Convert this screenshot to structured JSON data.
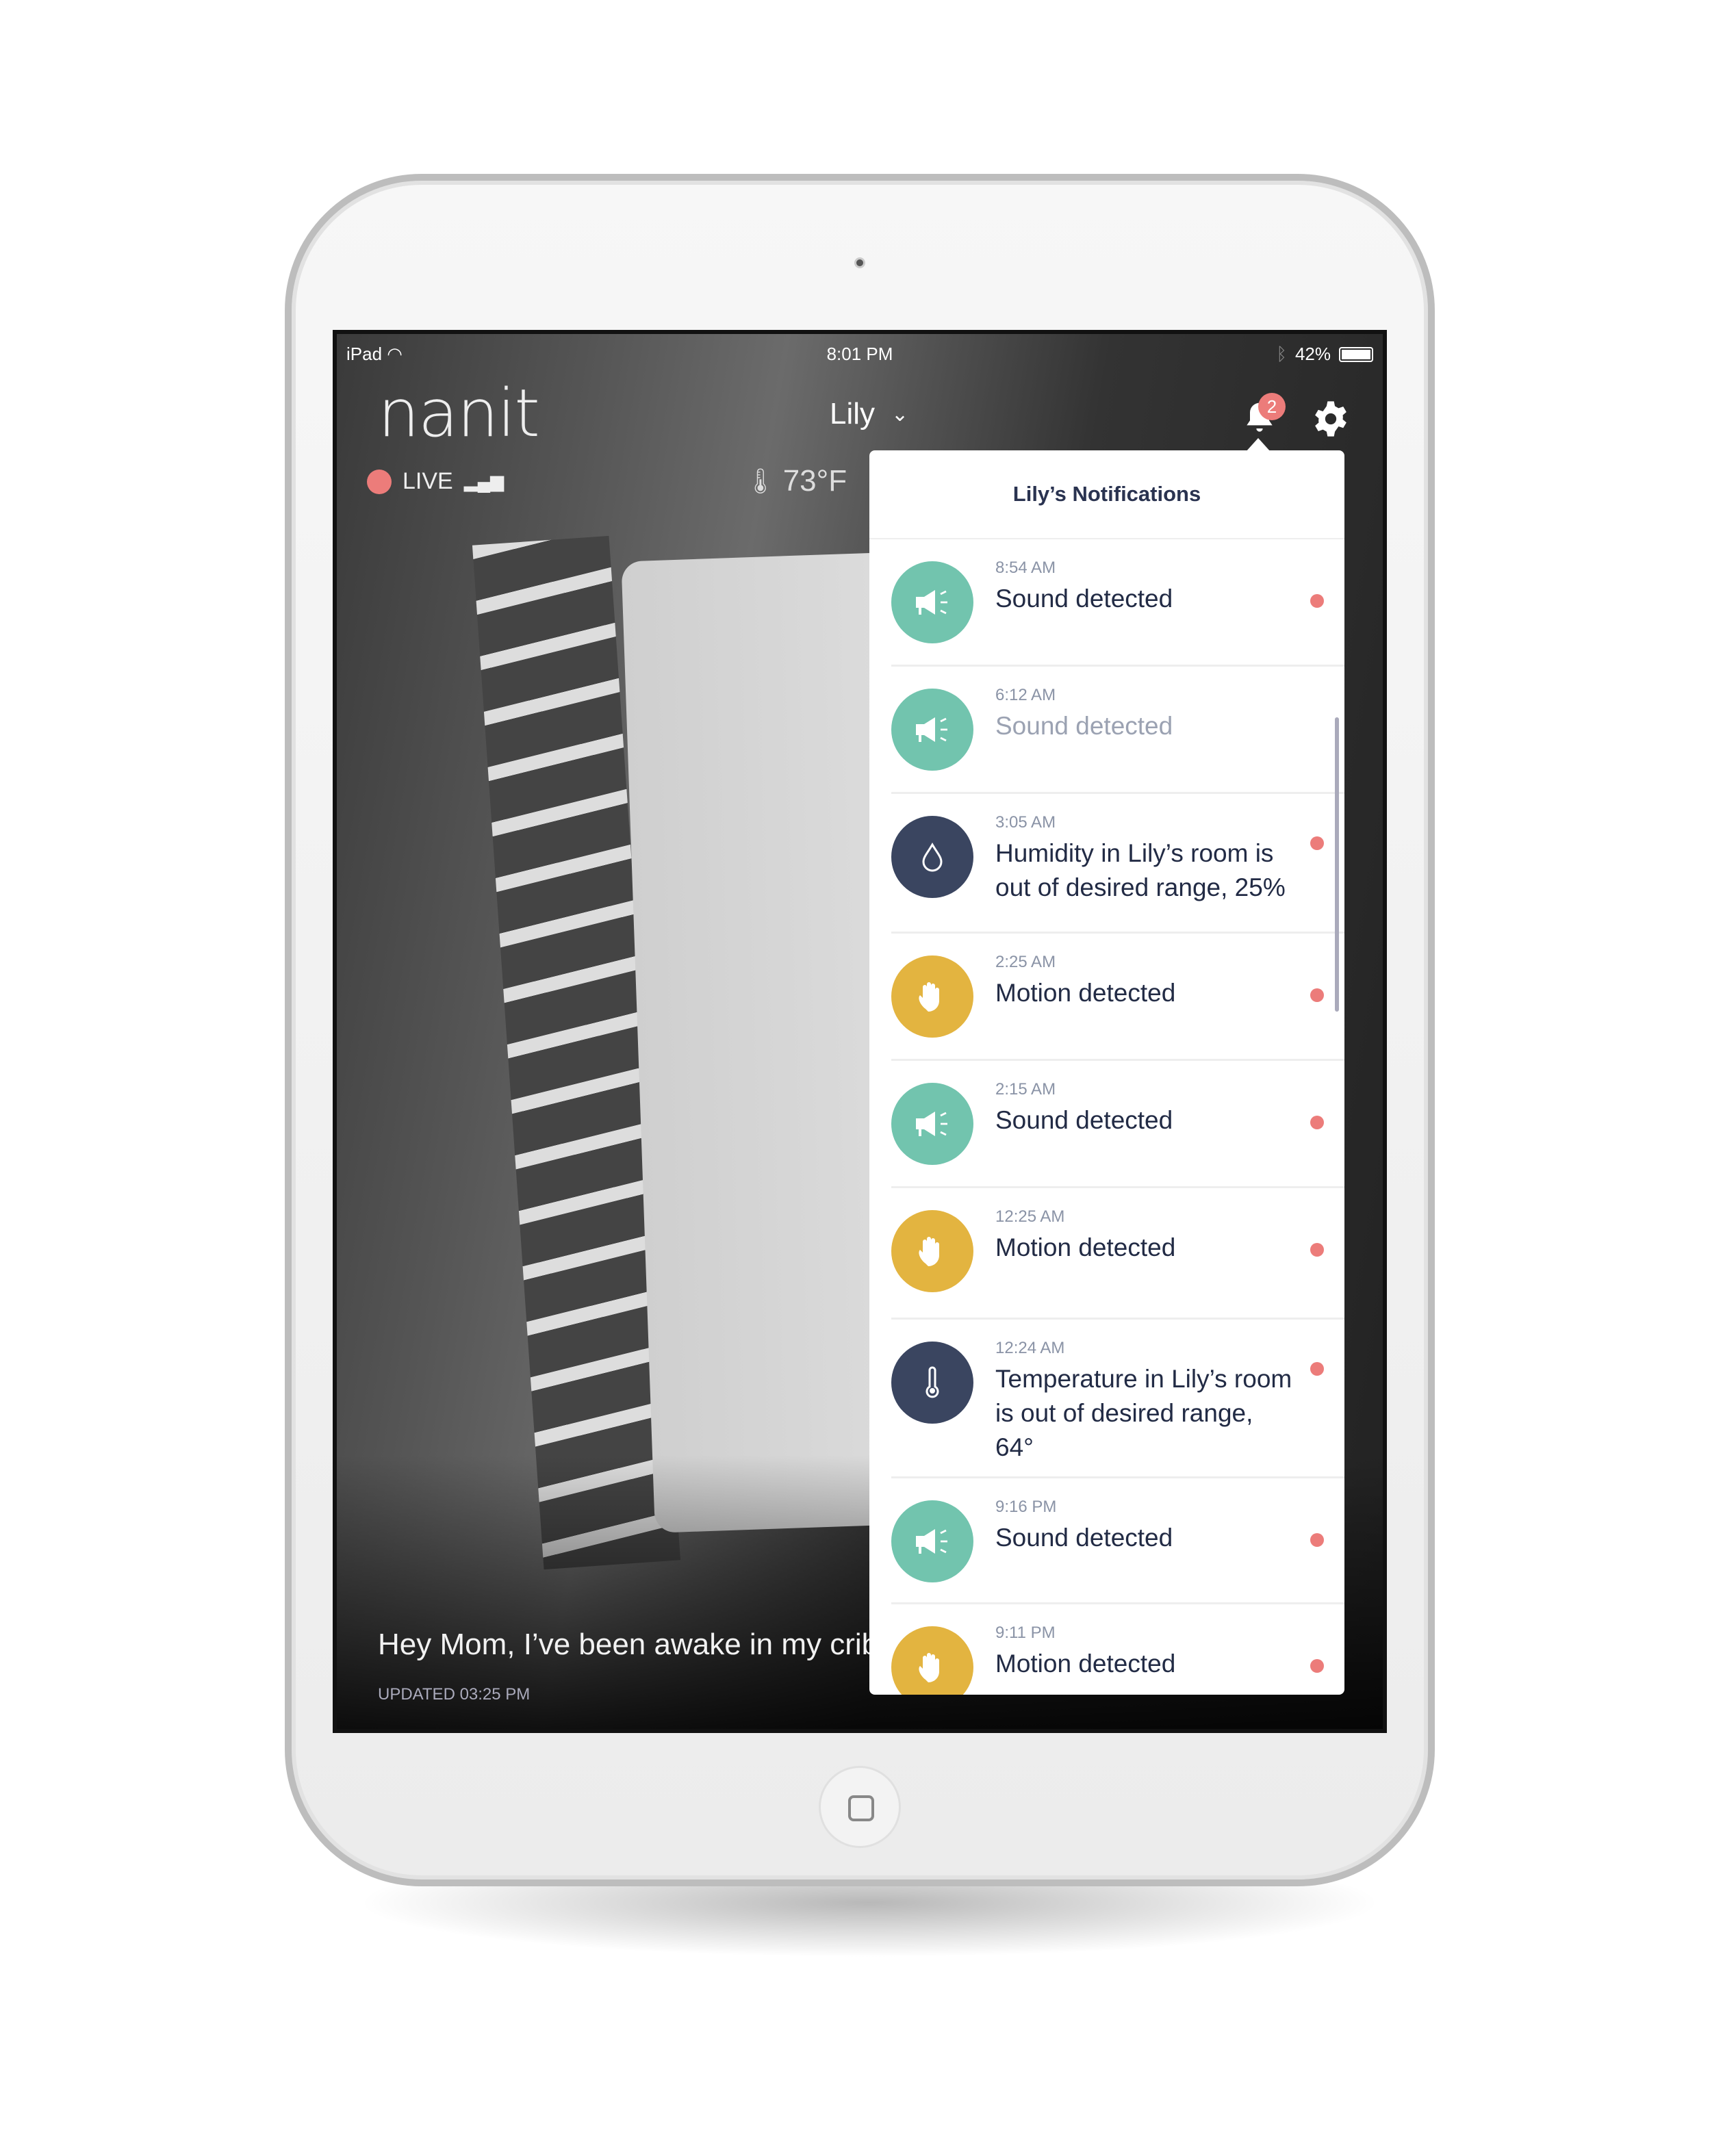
{
  "colors": {
    "sound": "#72c4ae",
    "humidity": "#3a4560",
    "motion": "#e3b440",
    "unread": "#ec7c7a"
  },
  "status_bar": {
    "device": "iPad",
    "time": "8:01 PM",
    "battery": "42%"
  },
  "header": {
    "logo": "nanit",
    "baby": "Lily",
    "notification_count": "2"
  },
  "stream": {
    "live_label": "LIVE",
    "temperature": "73°F",
    "caption": "Hey Mom, I’ve been awake in my crib",
    "updated": "UPDATED 03:25 PM"
  },
  "notifications": {
    "title": "Lily’s Notifications",
    "items": [
      {
        "time": "8:54 AM",
        "text": "Sound detected",
        "type": "sound",
        "icon": "megaphone-icon",
        "unread": true
      },
      {
        "time": "6:12 AM",
        "text": "Sound detected",
        "type": "sound",
        "icon": "megaphone-icon",
        "unread": false
      },
      {
        "time": "3:05 AM",
        "text": "Humidity in Lily’s room is out of desired range, 25%",
        "type": "humidity",
        "icon": "droplet-icon",
        "unread": true
      },
      {
        "time": "2:25 AM",
        "text": "Motion detected",
        "type": "motion",
        "icon": "hand-wave-icon",
        "unread": true
      },
      {
        "time": "2:15 AM",
        "text": "Sound detected",
        "type": "sound",
        "icon": "megaphone-icon",
        "unread": true
      },
      {
        "time": "12:25 AM",
        "text": "Motion detected",
        "type": "motion",
        "icon": "hand-wave-icon",
        "unread": true
      },
      {
        "time": "12:24 AM",
        "text": "Temperature in Lily’s room is out of desired range, 64°",
        "type": "humidity",
        "icon": "thermometer-icon",
        "unread": true
      },
      {
        "time": "9:16 PM",
        "text": "Sound detected",
        "type": "sound",
        "icon": "megaphone-icon",
        "unread": true
      },
      {
        "time": "9:11 PM",
        "text": "Motion detected",
        "type": "motion",
        "icon": "hand-wave-icon",
        "unread": true
      }
    ]
  }
}
